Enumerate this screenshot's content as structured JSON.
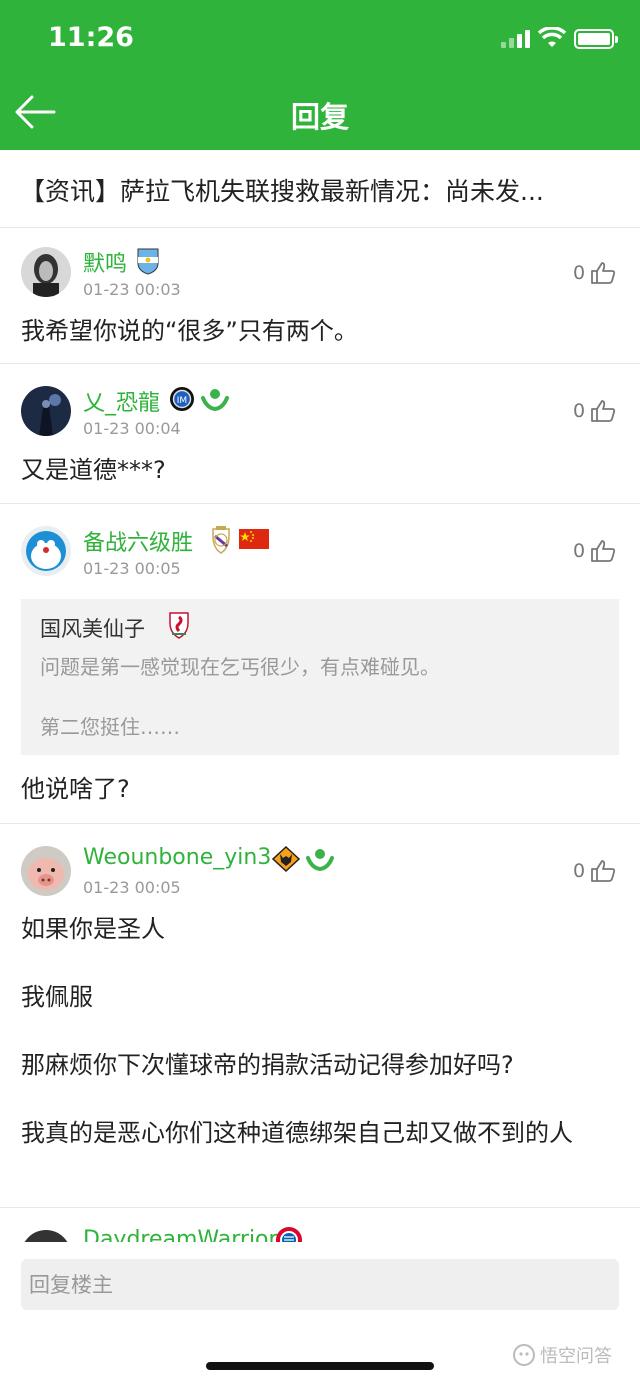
{
  "status_bar": {
    "time": "11:26"
  },
  "header": {
    "title": "回复"
  },
  "article": {
    "title": "【资讯】萨拉飞机失联搜救最新情况：尚未发..."
  },
  "comments": [
    {
      "username": "默鸣",
      "time": "01-23 00:03",
      "likes": "0",
      "text": "我希望你说的“很多”只有两个。"
    },
    {
      "username": "乂_恐龍",
      "time": "01-23 00:04",
      "likes": "0",
      "text": "又是道德***?"
    },
    {
      "username": "备战六级胜",
      "time": "01-23 00:05",
      "likes": "0",
      "quote": {
        "username": "国风美仙子",
        "line1": "问题是第一感觉现在乞丐很少，有点难碰见。",
        "line2": "第二您挺住……"
      },
      "text": "他说啥了?"
    },
    {
      "username": "Weounbone_yin3",
      "time": "01-23 00:05",
      "likes": "0",
      "paragraphs": [
        "如果你是圣人",
        "我佩服",
        "那麻烦你下次懂球帝的捐款活动记得参加好吗?",
        "我真的是恶心你们这种道德绑架自己却又做不到的人"
      ]
    },
    {
      "username": "DaydreamWarrior"
    }
  ],
  "reply_bar": {
    "placeholder": "回复楼主"
  },
  "watermark": {
    "text": "悟空问答"
  },
  "colors": {
    "brand_green": "#2fb33a"
  }
}
